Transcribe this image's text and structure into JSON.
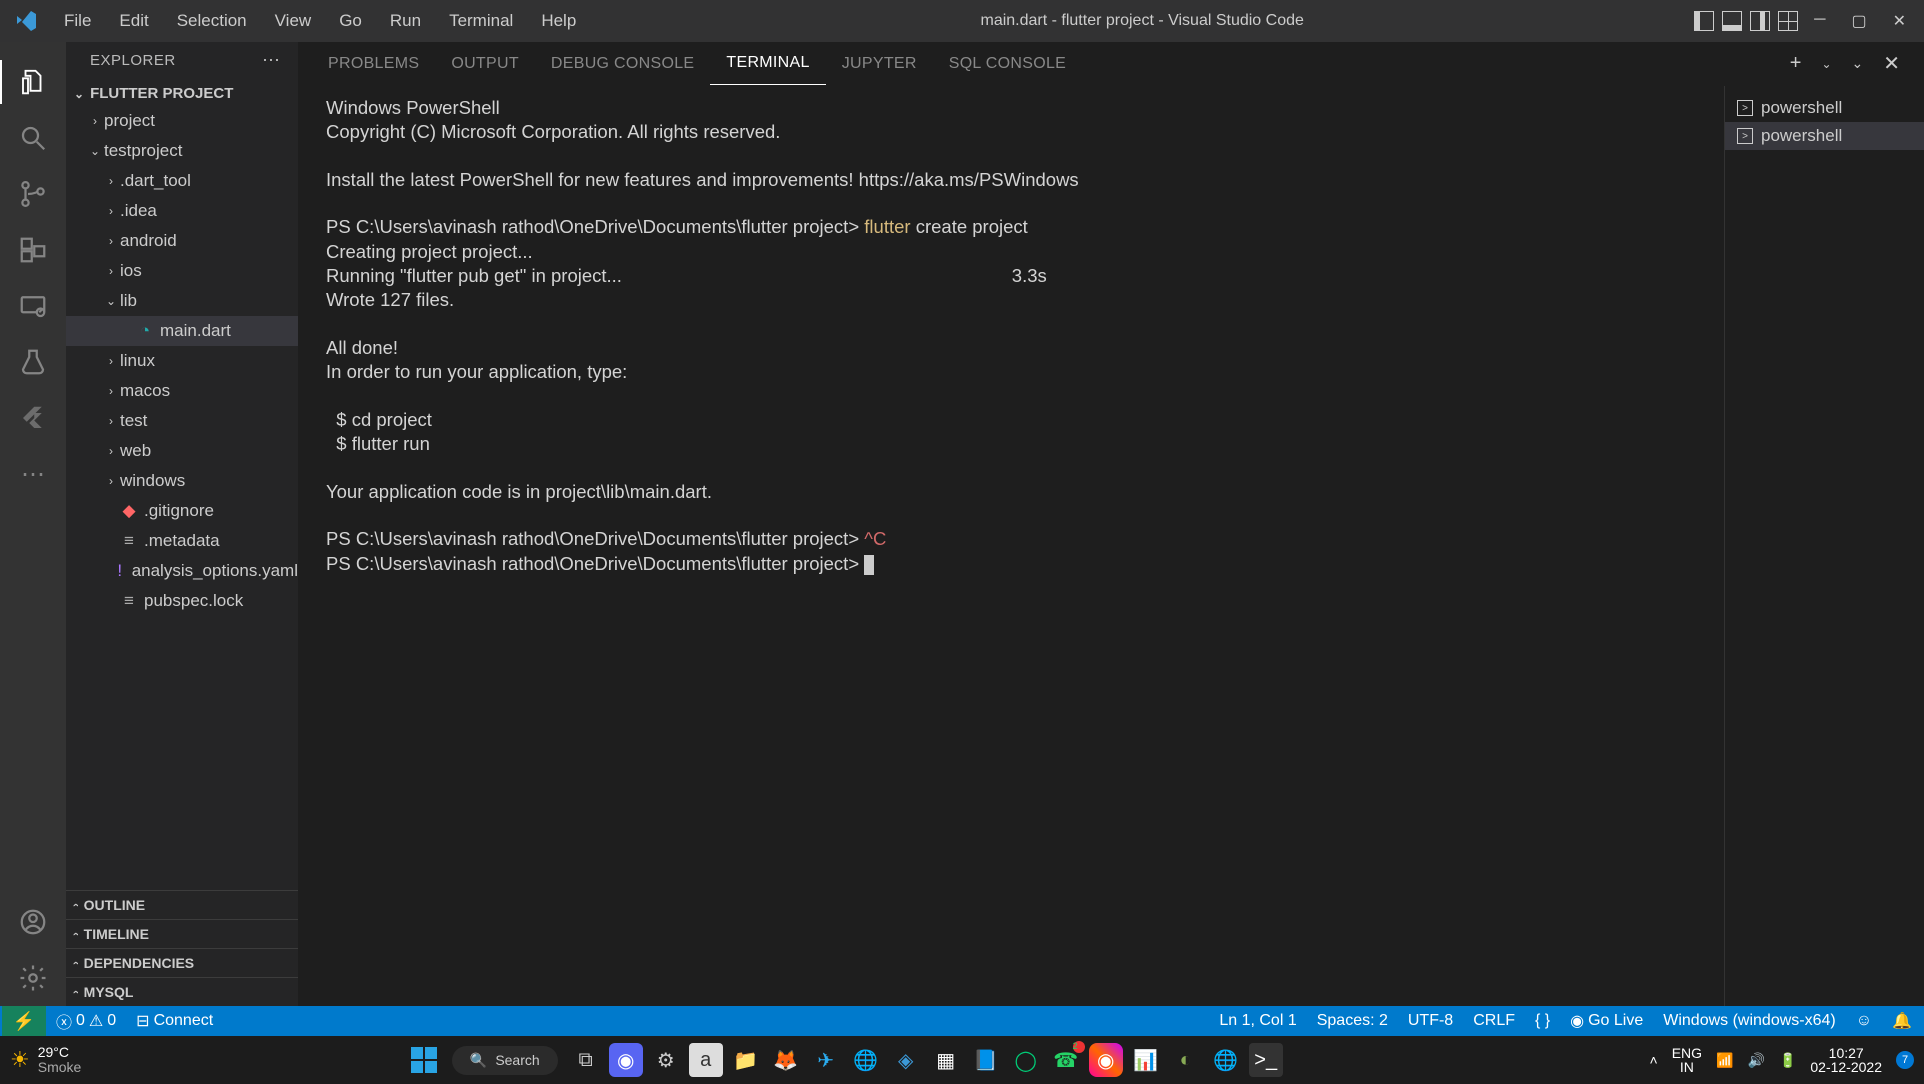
{
  "title_bar": {
    "menus": [
      "File",
      "Edit",
      "Selection",
      "View",
      "Go",
      "Run",
      "Terminal",
      "Help"
    ],
    "window_title": "main.dart - flutter project - Visual Studio Code"
  },
  "sidebar": {
    "header": "EXPLORER",
    "project_title": "FLUTTER PROJECT",
    "tree": [
      {
        "label": "project",
        "type": "folder",
        "open": false,
        "indent": 1
      },
      {
        "label": "testproject",
        "type": "folder",
        "open": true,
        "indent": 1
      },
      {
        "label": ".dart_tool",
        "type": "folder",
        "open": false,
        "indent": 2
      },
      {
        "label": ".idea",
        "type": "folder",
        "open": false,
        "indent": 2
      },
      {
        "label": "android",
        "type": "folder",
        "open": false,
        "indent": 2
      },
      {
        "label": "ios",
        "type": "folder",
        "open": false,
        "indent": 2
      },
      {
        "label": "lib",
        "type": "folder",
        "open": true,
        "indent": 2
      },
      {
        "label": "main.dart",
        "type": "file",
        "icon": "dart",
        "indent": 3,
        "selected": true
      },
      {
        "label": "linux",
        "type": "folder",
        "open": false,
        "indent": 2
      },
      {
        "label": "macos",
        "type": "folder",
        "open": false,
        "indent": 2
      },
      {
        "label": "test",
        "type": "folder",
        "open": false,
        "indent": 2
      },
      {
        "label": "web",
        "type": "folder",
        "open": false,
        "indent": 2
      },
      {
        "label": "windows",
        "type": "folder",
        "open": false,
        "indent": 2
      },
      {
        "label": ".gitignore",
        "type": "file",
        "icon": "git",
        "indent": 2
      },
      {
        "label": ".metadata",
        "type": "file",
        "icon": "meta",
        "indent": 2
      },
      {
        "label": "analysis_options.yaml",
        "type": "file",
        "icon": "yaml",
        "indent": 2
      },
      {
        "label": "pubspec.lock",
        "type": "file",
        "icon": "lock",
        "indent": 2
      }
    ],
    "collapsed_sections": [
      "OUTLINE",
      "TIMELINE",
      "DEPENDENCIES",
      "MYSQL"
    ]
  },
  "panel": {
    "tabs": [
      "PROBLEMS",
      "OUTPUT",
      "DEBUG CONSOLE",
      "TERMINAL",
      "JUPYTER",
      "SQL CONSOLE"
    ],
    "active_tab": "TERMINAL",
    "terminal_entries": [
      "powershell",
      "powershell"
    ],
    "terminal_text": {
      "l1": "Windows PowerShell",
      "l2": "Copyright (C) Microsoft Corporation. All rights reserved.",
      "l3": "",
      "l4": "Install the latest PowerShell for new features and improvements! https://aka.ms/PSWindows",
      "l5": "",
      "p1": "PS C:\\Users\\avinash rathod\\OneDrive\\Documents\\flutter project> ",
      "p1_cmd1": "flutter",
      "p1_cmd2": " create project",
      "l7": "Creating project project...",
      "l8a": "Running \"flutter pub get\" in project...",
      "l8b": "3.3s",
      "l9": "Wrote 127 files.",
      "l10": "",
      "l11": "All done!",
      "l12": "In order to run your application, type:",
      "l13": "",
      "l14": "  $ cd project",
      "l15": "  $ flutter run",
      "l16": "",
      "l17": "Your application code is in project\\lib\\main.dart.",
      "l18": "",
      "p2": "PS C:\\Users\\avinash rathod\\OneDrive\\Documents\\flutter project> ",
      "p2_cmd": "^C",
      "p3": "PS C:\\Users\\avinash rathod\\OneDrive\\Documents\\flutter project> "
    }
  },
  "status_bar": {
    "errors": "0",
    "warnings": "0",
    "connect": "Connect",
    "ln_col": "Ln 1, Col 1",
    "spaces": "Spaces: 2",
    "encoding": "UTF-8",
    "eol": "CRLF",
    "lang": "{ }",
    "golive": "Go Live",
    "device": "Windows (windows-x64)"
  },
  "taskbar": {
    "temp": "29°C",
    "weather": "Smoke",
    "search_placeholder": "Search",
    "lang1": "ENG",
    "lang2": "IN",
    "time": "10:27",
    "date": "02-12-2022",
    "notif_count": "7"
  }
}
